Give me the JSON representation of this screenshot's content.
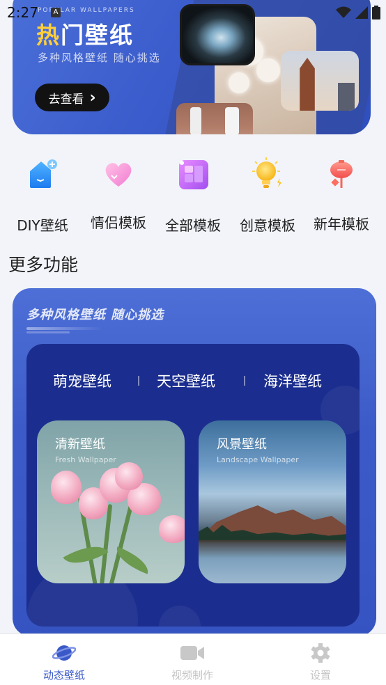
{
  "status_bar": {
    "time": "2:27",
    "notification": "A"
  },
  "banner": {
    "eng_caption": "POPULAR WALLPAPERS",
    "title_hot": "热",
    "title_rest": "门壁纸",
    "subtitle": "多种风格壁纸  随心挑选",
    "button_label": "去查看",
    "button_arrow": "›"
  },
  "categories": [
    {
      "label": "DIY壁纸",
      "icon": "diy-house-icon"
    },
    {
      "label": "情侣模板",
      "icon": "heart-icon"
    },
    {
      "label": "全部模板",
      "icon": "grid-icon"
    },
    {
      "label": "创意模板",
      "icon": "lightbulb-icon"
    },
    {
      "label": "新年模板",
      "icon": "lantern-icon"
    }
  ],
  "more_title": "更多功能",
  "feature": {
    "headline": "多种风格壁纸  随心挑选",
    "tabs": [
      "萌宠壁纸",
      "天空壁纸",
      "海洋壁纸"
    ],
    "tiles": [
      {
        "title": "清新壁纸",
        "subtitle": "Fresh Wallpaper"
      },
      {
        "title": "风景壁纸",
        "subtitle": "Landscape Wallpaper"
      }
    ]
  },
  "bottom_nav": [
    {
      "label": "动态壁纸",
      "icon": "planet-icon",
      "active": true
    },
    {
      "label": "视频制作",
      "icon": "video-camera-icon",
      "active": false
    },
    {
      "label": "设置",
      "icon": "gear-icon",
      "active": false
    }
  ],
  "colors": {
    "accent": "#3a58c8",
    "banner_blue": "#3b5ccc",
    "feature_inner": "#1b2e8f",
    "hot_yellow": "#ffcf3a"
  }
}
